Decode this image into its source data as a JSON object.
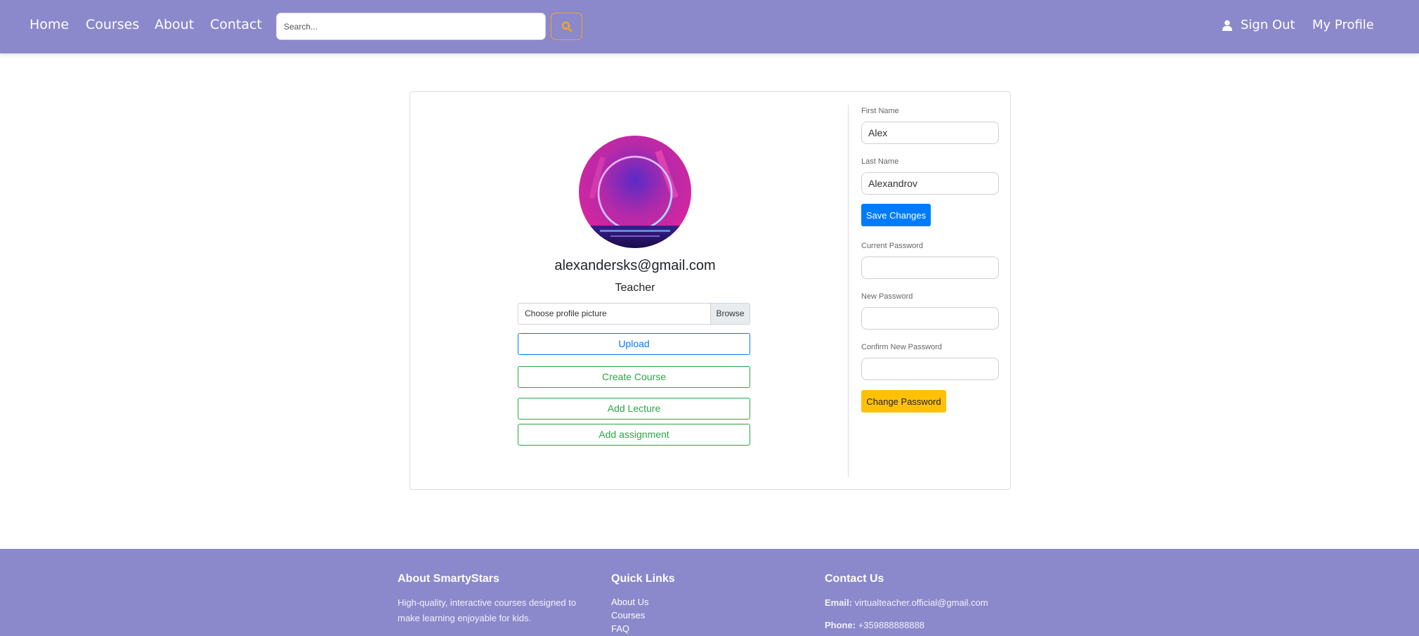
{
  "nav": {
    "links": [
      "Home",
      "Courses",
      "About",
      "Contact"
    ],
    "search_placeholder": "Search...",
    "sign_out": "Sign Out",
    "my_profile": "My Profile"
  },
  "profile": {
    "email": "alexandersks@gmail.com",
    "role": "Teacher",
    "file_label": "Choose profile picture",
    "browse_label": "Browse",
    "upload_label": "Upload",
    "create_course_label": "Create Course",
    "add_lecture_label": "Add Lecture",
    "add_assignment_label": "Add assignment"
  },
  "form": {
    "first_name_label": "First Name",
    "first_name_value": "Alex",
    "last_name_label": "Last Name",
    "last_name_value": "Alexandrov",
    "save_label": "Save Changes",
    "current_password_label": "Current Password",
    "new_password_label": "New Password",
    "confirm_password_label": "Confirm New Password",
    "change_password_label": "Change Password"
  },
  "footer": {
    "about_title": "About SmartyStars",
    "about_text": "High-quality, interactive courses designed to make learning enjoyable for kids.",
    "links_title": "Quick Links",
    "links": [
      "About Us",
      "Courses",
      "FAQ"
    ],
    "contact_title": "Contact Us",
    "email_label": "Email:",
    "email_value": "virtualteacher.official@gmail.com",
    "phone_label": "Phone:",
    "phone_value": "+359888888888"
  },
  "colors": {
    "nav_bg": "#8b88cb",
    "primary": "#007bff",
    "success": "#28a745",
    "warning": "#ffc107",
    "search_accent": "#f5a623"
  }
}
